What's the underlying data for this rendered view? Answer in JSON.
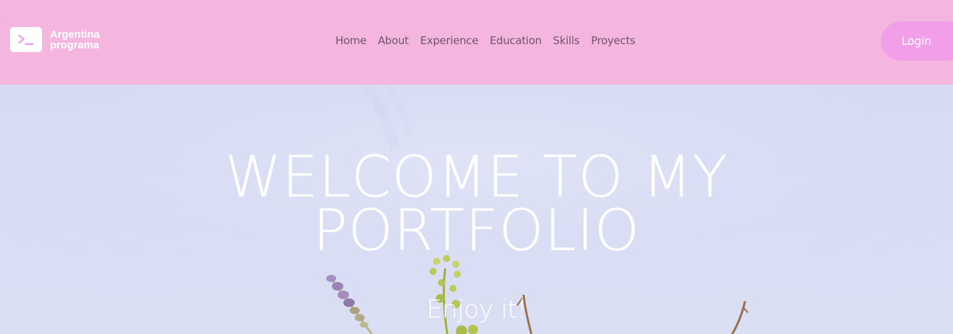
{
  "brand": {
    "line1": "Argentina",
    "line2": "programa",
    "logo_icon": "terminal-icon"
  },
  "nav": {
    "items": [
      {
        "label": "Home"
      },
      {
        "label": "About"
      },
      {
        "label": "Experience"
      },
      {
        "label": "Education"
      },
      {
        "label": "Skills"
      },
      {
        "label": "Proyects"
      }
    ]
  },
  "login": {
    "label": "Login"
  },
  "hero": {
    "title_line1": "WELCOME TO MY",
    "title_line2": "PORTFOLIO",
    "subtitle": "Enjoy it!"
  },
  "colors": {
    "navbar_bg": "#f4b5de",
    "login_bg": "#f29ee8",
    "hero_bg": "#d9ddf4",
    "nav_text": "#6e5768",
    "logo_accent": "#f29ee8"
  }
}
